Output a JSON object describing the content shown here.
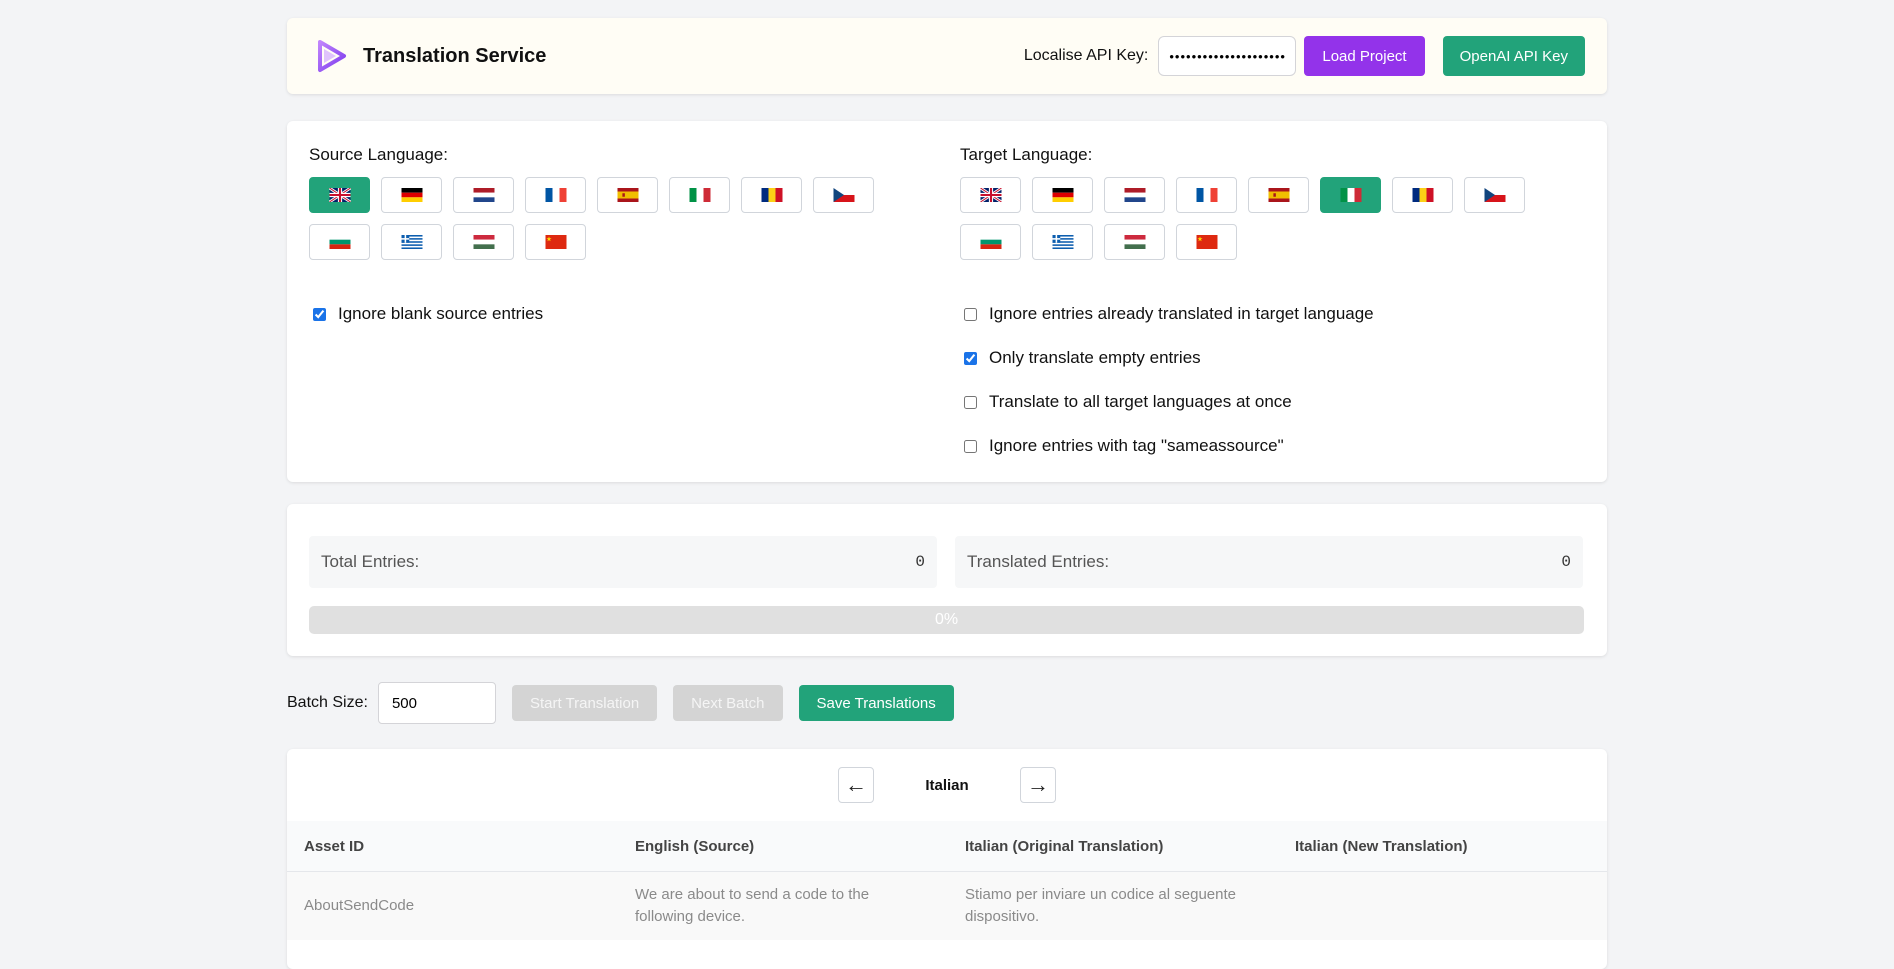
{
  "header": {
    "title": "Translation Service",
    "api_key_label": "Localise API Key:",
    "api_key_value": "••••••••••••••••••••••",
    "load_button": "Load Project",
    "openai_button": "OpenAI API Key"
  },
  "source": {
    "title": "Source Language:",
    "flags": [
      "uk",
      "de",
      "nl",
      "fr",
      "es",
      "it",
      "ro",
      "cz",
      "bg",
      "gr",
      "hu",
      "cn"
    ],
    "selected": "uk",
    "options": [
      {
        "label": "Ignore blank source entries",
        "checked": true
      }
    ]
  },
  "target": {
    "title": "Target Language:",
    "flags": [
      "uk",
      "de",
      "nl",
      "fr",
      "es",
      "it",
      "ro",
      "cz",
      "bg",
      "gr",
      "hu",
      "cn"
    ],
    "selected": "it",
    "options": [
      {
        "label": "Ignore entries already translated in target language",
        "checked": false
      },
      {
        "label": "Only translate empty entries",
        "checked": true
      },
      {
        "label": "Translate to all target languages at once",
        "checked": false
      },
      {
        "label": "Ignore entries with tag \"sameassource\"",
        "checked": false
      }
    ]
  },
  "stats": {
    "total_label": "Total Entries:",
    "total_value": "0",
    "translated_label": "Translated Entries:",
    "translated_value": "0",
    "progress_text": "0%",
    "progress_fraction": 0
  },
  "batch": {
    "label": "Batch Size:",
    "value": "500",
    "start_button": "Start Translation",
    "next_button": "Next Batch",
    "save_button": "Save Translations"
  },
  "table": {
    "prev_icon": "←",
    "next_icon": "→",
    "current_language": "Italian",
    "columns": [
      "Asset ID",
      "English (Source)",
      "Italian (Original Translation)",
      "Italian (New Translation)"
    ],
    "rows": [
      {
        "asset_id": "AboutSendCode",
        "source": "We are about to send a code to the following device.",
        "original": "Stiamo per inviare un codice al seguente dispositivo.",
        "new": ""
      }
    ]
  },
  "colors": {
    "accent_green": "#22a37a",
    "accent_purple": "#9333ea",
    "header_bg": "#fffdf5"
  }
}
